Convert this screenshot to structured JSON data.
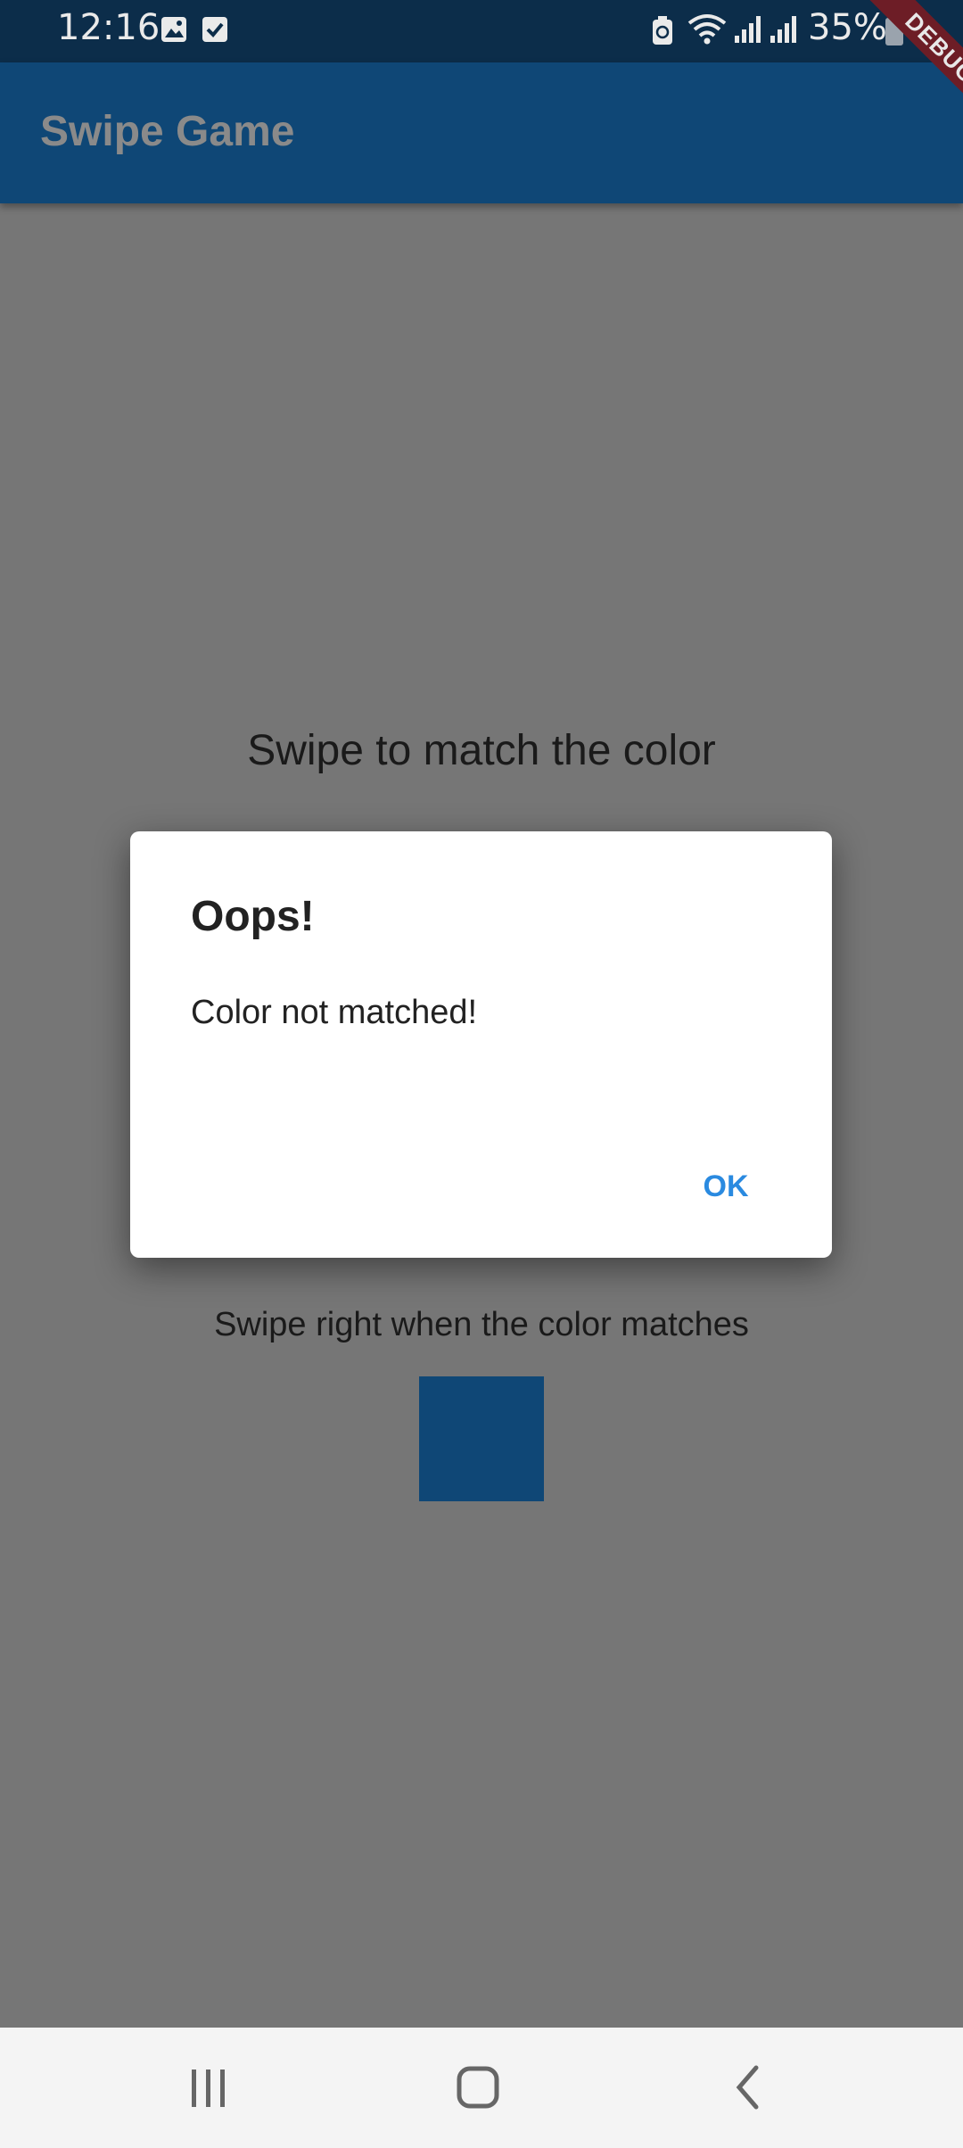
{
  "status_bar": {
    "time": "12:16",
    "battery": "35%",
    "icons": [
      "gallery-icon",
      "checkbox-icon",
      "battery-saver-icon",
      "wifi-icon",
      "signal-icon",
      "signal-icon",
      "battery-icon"
    ]
  },
  "app_bar": {
    "title": "Swipe Game",
    "color": "#0f4776"
  },
  "debug_banner": {
    "label": "DEBUG"
  },
  "game": {
    "prompt": "Swipe to match the color",
    "hint": "Swipe right when the color matches",
    "swatch_color": "#0f4776"
  },
  "dialog": {
    "title": "Oops!",
    "message": "Color not matched!",
    "ok_label": "OK"
  },
  "nav_bar": {
    "icons": [
      "recent-apps-icon",
      "home-icon",
      "back-icon"
    ]
  },
  "colors": {
    "scrim": "#767676",
    "accent": "#2a8ae0",
    "debug": "#6d1d26"
  }
}
